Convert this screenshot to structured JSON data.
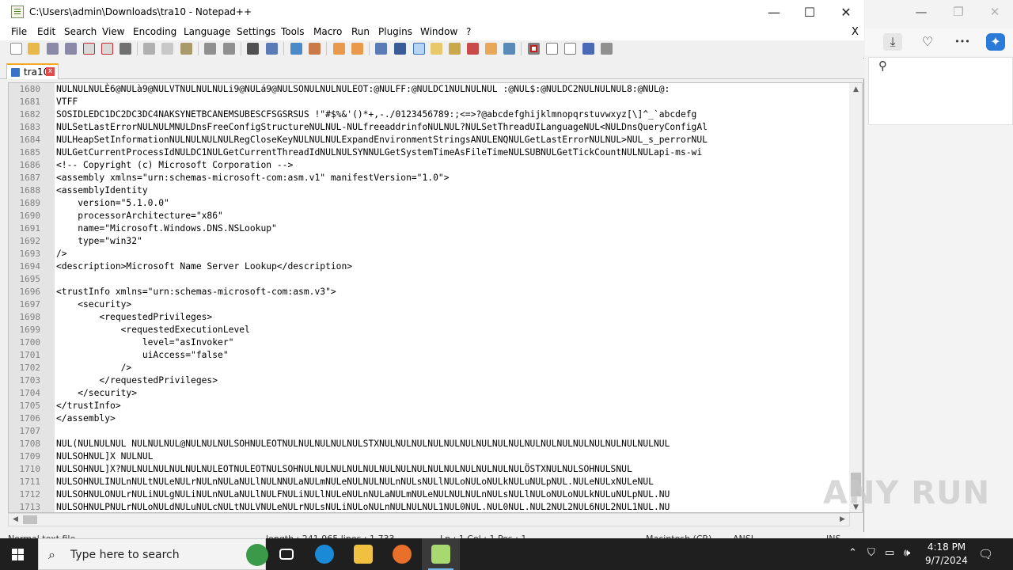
{
  "window": {
    "title": "C:\\Users\\admin\\Downloads\\tra10 - Notepad++",
    "minimize": "—",
    "maximize": "☐",
    "close": "✕"
  },
  "menu": {
    "items": [
      "File",
      "Edit",
      "Search",
      "View",
      "Encoding",
      "Language",
      "Settings",
      "Tools",
      "Macro",
      "Run",
      "Plugins",
      "Window",
      "?"
    ],
    "close_doc": "X"
  },
  "tab": {
    "label": "tra10",
    "close": "x"
  },
  "editor": {
    "lines": [
      {
        "n": "1680",
        "t": "NULNULNULÈ6@NULà9@NULVTNULNULNULi9@NULá9@NULSONULNULNULEOT:@NULFF:@NULDC1NULNULNUL :@NUL$:@NULDC2NULNULNUL8:@NUL@:"
      },
      {
        "n": "1681",
        "t": "VTFF"
      },
      {
        "n": "1682",
        "t": "SOSIDLEDC1DC2DC3DC4NAKSYNETBCANEMSUBESCFSGSRSUS !\"#$%&'()*+,-./0123456789:;<=>?@abcdefghijklmnopqrstuvwxyz[\\]^_`abcdefg"
      },
      {
        "n": "1683",
        "t": "NULSetLastErrorNULNULMNULDnsFreeConfigStructureNULNUL-NULfreeaddrinfoNULNUL?NULSetThreadUILanguageNUL<NULDnsQueryConfigAl"
      },
      {
        "n": "1684",
        "t": "NULHeapSetInformationNULNULNULNULRegCloseKeyNULNULNULExpandEnvironmentStringsANULENQNULGetLastErrorNULNUL>NUL_s_perrorNUL"
      },
      {
        "n": "1685",
        "t": "NULGetCurrentProcessIdNULDC1NULGetCurrentThreadIdNULNULSYNNULGetSystemTimeAsFileTimeNULSUBNULGetTickCountNULNULapi-ms-wi"
      },
      {
        "n": "1686",
        "t": "<!-- Copyright (c) Microsoft Corporation -->"
      },
      {
        "n": "1687",
        "t": "<assembly xmlns=\"urn:schemas-microsoft-com:asm.v1\" manifestVersion=\"1.0\">"
      },
      {
        "n": "1688",
        "t": "<assemblyIdentity"
      },
      {
        "n": "1689",
        "t": "    version=\"5.1.0.0\""
      },
      {
        "n": "1690",
        "t": "    processorArchitecture=\"x86\""
      },
      {
        "n": "1691",
        "t": "    name=\"Microsoft.Windows.DNS.NSLookup\""
      },
      {
        "n": "1692",
        "t": "    type=\"win32\""
      },
      {
        "n": "1693",
        "t": "/>"
      },
      {
        "n": "1694",
        "t": "<description>Microsoft Name Server Lookup</description>"
      },
      {
        "n": "1695",
        "t": ""
      },
      {
        "n": "1696",
        "t": "<trustInfo xmlns=\"urn:schemas-microsoft-com:asm.v3\">"
      },
      {
        "n": "1697",
        "t": "    <security>"
      },
      {
        "n": "1698",
        "t": "        <requestedPrivileges>"
      },
      {
        "n": "1699",
        "t": "            <requestedExecutionLevel"
      },
      {
        "n": "1700",
        "t": "                level=\"asInvoker\""
      },
      {
        "n": "1701",
        "t": "                uiAccess=\"false\""
      },
      {
        "n": "1702",
        "t": "            />"
      },
      {
        "n": "1703",
        "t": "        </requestedPrivileges>"
      },
      {
        "n": "1704",
        "t": "    </security>"
      },
      {
        "n": "1705",
        "t": "</trustInfo>"
      },
      {
        "n": "1706",
        "t": "</assembly>"
      },
      {
        "n": "1707",
        "t": ""
      },
      {
        "n": "1708",
        "t": "NUL(NULNULNUL NULNULNUL@NULNULNULSOHNULEOTNULNULNULNULNULSTXNULNULNULNULNULNULNULNULNULNULNULNULNULNULNULNULNULNUL"
      },
      {
        "n": "1709",
        "t": "NULSOHNUL]X NULNUL"
      },
      {
        "n": "1710",
        "t": "NULSOHNUL]X?NULNULNULNULNULNULEOTNULEOTNULSOHNULNULNULNULNULNULNULNULNULNULNULNULNULNULÖSTXNULNULSOHNULSNUL"
      },
      {
        "n": "1711",
        "t": "NULSOHNULINULnNULtNULeNULrNULnNULaNULlNULNNULaNULmNULeNULNULNULnNULsNULlNULoNULoNULkNULuNULpNUL.NULeNULxNULeNUL"
      },
      {
        "n": "1712",
        "t": "NULSOHNULONULrNULiNULgNULiNULnNULaNULlNULFNULiNULlNULeNULnNULaNULmNULeNULNULNULnNULsNULlNULoNULoNULkNULuNULpNUL.NU"
      },
      {
        "n": "1713",
        "t": "NULSOHNULPNULrNULoNULdNULuNULcNULtNULVNULeNULrNULsNULiNULoNULnNULNULNUL1NUL0NUL.NUL0NUL.NUL2NUL2NUL6NUL2NUL1NUL.NU"
      }
    ]
  },
  "statusbar": {
    "type": "Normal text file",
    "length": "length : 241,965   lines : 1,733",
    "pos": "Ln : 1    Col : 1    Pos : 1",
    "eol": "Macintosh (CR)",
    "enc": "ANSI",
    "mode": "INS"
  },
  "browser_side": {
    "minimize": "—",
    "restore": "❐",
    "close": "✕",
    "more": "•••"
  },
  "taskbar": {
    "search_placeholder": "Type here to search",
    "time": "4:18 PM",
    "date": "9/7/2024"
  },
  "watermark": "ANY RUN",
  "colors": {
    "accent": "#f5a623",
    "taskbar": "#1f1f1f",
    "ctrl_bg": "#000000"
  }
}
